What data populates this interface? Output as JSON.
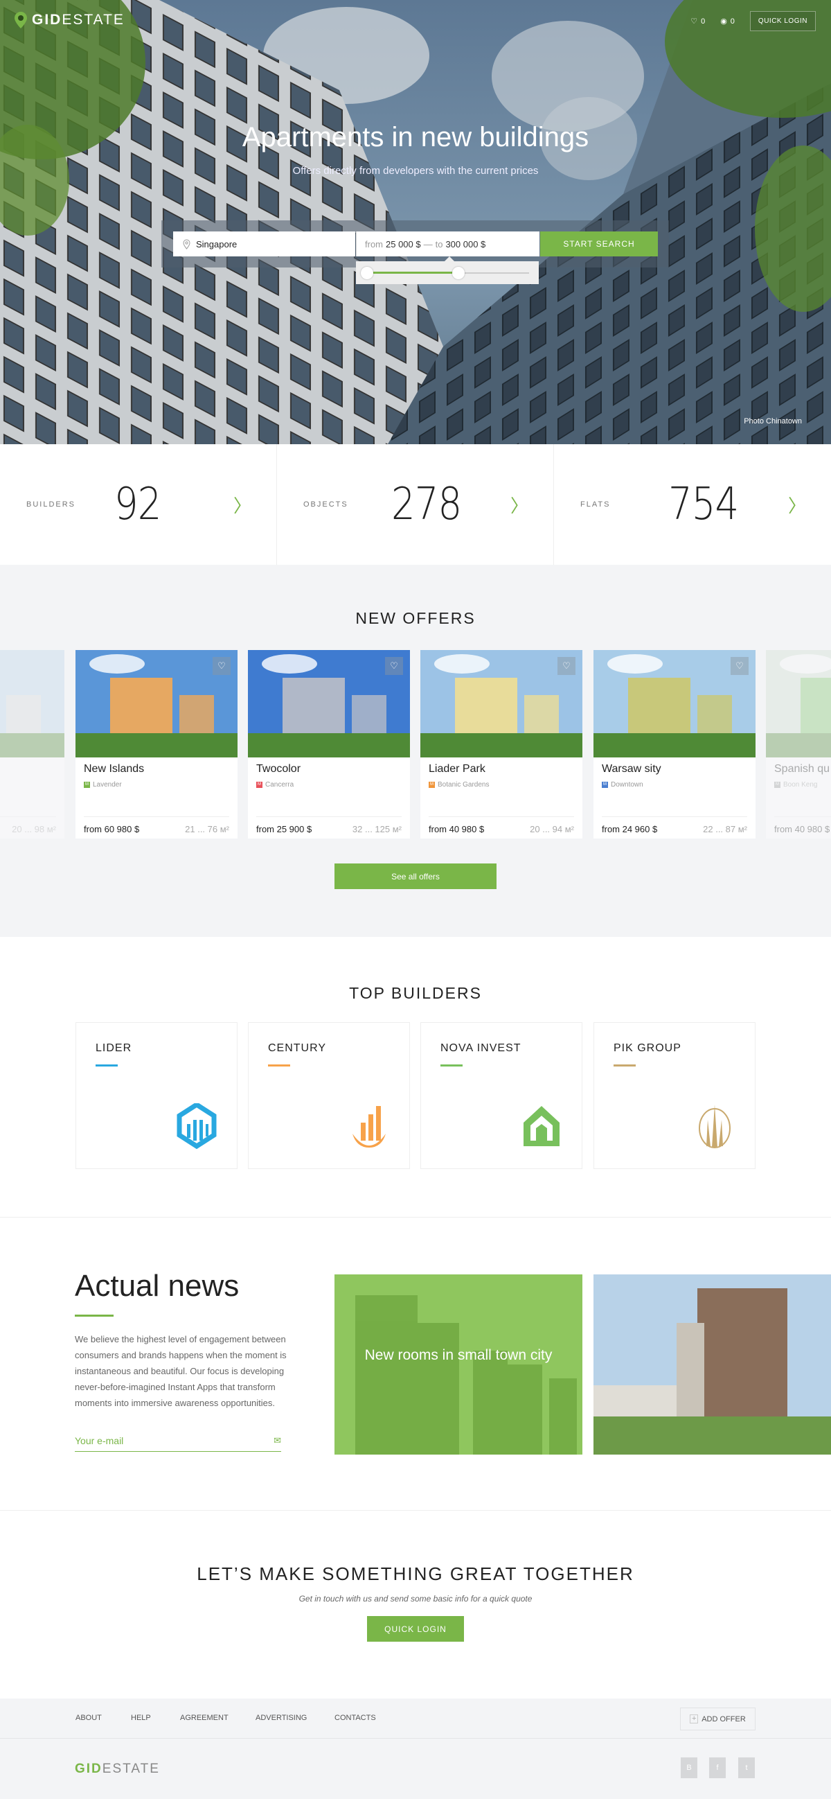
{
  "header": {
    "logo_bold": "GID",
    "logo_rest": "ESTATE",
    "favorites_count": "0",
    "views_count": "0",
    "quick_login": "QUICK LOGIN"
  },
  "hero": {
    "title": "Apartments in new buildings",
    "subtitle": "Offers directly from developers with the current prices",
    "search": {
      "location_value": "Singapore",
      "price_from_label": "from",
      "price_from": "25 000 $",
      "price_dash": "—",
      "price_to_label": "to",
      "price_to": "300 000 $",
      "button": "START SEARCH",
      "slider_range_fraction": [
        0.0,
        0.43
      ]
    },
    "credit_label": "Photo",
    "credit_place": "Chinatown"
  },
  "stats": [
    {
      "label": "BUILDERS",
      "value": "92"
    },
    {
      "label": "OBJECTS",
      "value": "278"
    },
    {
      "label": "FLATS",
      "value": "754"
    }
  ],
  "offers": {
    "title": "NEW OFFERS",
    "see_all": "See all offers",
    "cards": [
      {
        "name": "",
        "metro": "",
        "metro_color": "#7ab648",
        "price": "",
        "area": "20 ... 98 м²"
      },
      {
        "name": "New Islands",
        "metro": "Lavender",
        "metro_color": "#7ab648",
        "price": "from 60 980 $",
        "area": "21 ... 76 м²"
      },
      {
        "name": "Twocolor",
        "metro": "Cancerra",
        "metro_color": "#e8515a",
        "price": "from 25 900 $",
        "area": "32 ... 125 м²"
      },
      {
        "name": "Liader Park",
        "metro": "Botanic Gardens",
        "metro_color": "#f0953a",
        "price": "from 40 980 $",
        "area": "20 ... 94 м²"
      },
      {
        "name": "Warsaw sity",
        "metro": "Downtown",
        "metro_color": "#4a7fd0",
        "price": "from 24 960 $",
        "area": "22 ... 87 м²"
      },
      {
        "name": "Spanish qu",
        "metro": "Boon Keng",
        "metro_color": "#999999",
        "price": "from 40 980 $",
        "area": ""
      }
    ]
  },
  "builders": {
    "title": "TOP BUILDERS",
    "items": [
      {
        "name": "LIDER",
        "color": "#29a8e0",
        "icon": "hexagon-building-logo"
      },
      {
        "name": "CENTURY",
        "color": "#f7a24a",
        "icon": "bar-chart-bowl-logo"
      },
      {
        "name": "NOVA INVEST",
        "color": "#78c05c",
        "icon": "house-spiral-logo"
      },
      {
        "name": "PIK GROUP",
        "color": "#c9a96e",
        "icon": "oval-tower-logo"
      }
    ]
  },
  "news": {
    "title": "Actual news",
    "text": "We believe the highest level of engagement between consumers and brands happens when the moment is instantaneous and beautiful. Our focus is developing never-before-imagined Instant Apps that transform moments into immersive awareness opportunities.",
    "email_placeholder": "Your e-mail",
    "tile_caption": "New rooms in small town city"
  },
  "cta": {
    "title": "LET’S MAKE SOMETHING GREAT TOGETHER",
    "subtitle": "Get in touch with us and send some basic info for a quick quote",
    "button": "QUICK LOGIN"
  },
  "footer": {
    "links": [
      "ABOUT",
      "HELP",
      "AGREEMENT",
      "ADVERTISING",
      "CONTACTS"
    ],
    "add_offer": "ADD OFFER",
    "logo_bold": "GID",
    "logo_rest": "ESTATE",
    "social": [
      "В",
      "f",
      "t"
    ]
  },
  "colors": {
    "accent": "#7ab648",
    "section_bg": "#f3f4f6"
  }
}
